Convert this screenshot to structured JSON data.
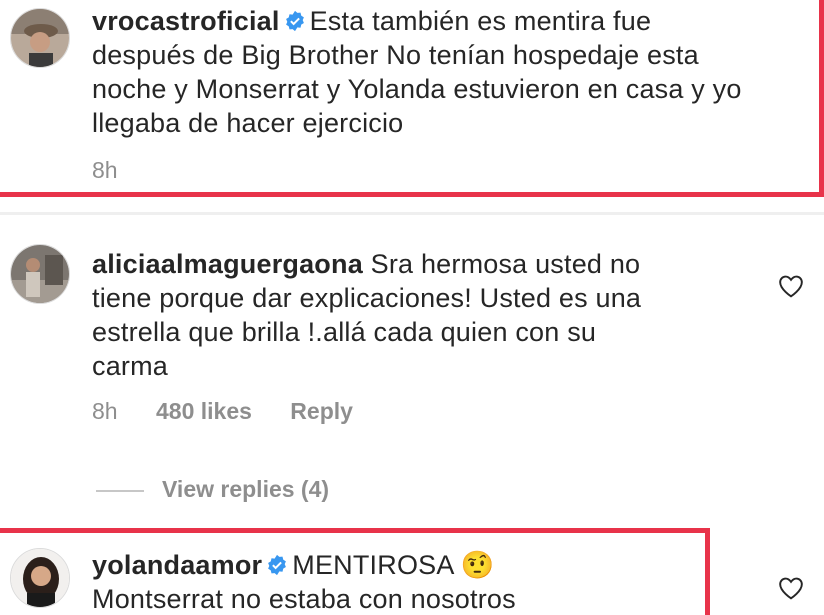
{
  "comments": [
    {
      "username": "vrocastroficial",
      "verified": true,
      "text": "Esta también es mentira fue después de Big Brother No tenían hospedaje esta noche y Monserrat y Yolanda estuvieron en casa y yo llegaba de hacer ejercicio",
      "lines": [
        "Esta también es mentira fue",
        "después de Big Brother No tenían hospedaje esta",
        "noche y Monserrat y Yolanda estuvieron en casa y yo",
        "llegaba de hacer ejercicio"
      ],
      "time": "8h",
      "highlighted": true
    },
    {
      "username": "aliciaalmaguergaona",
      "verified": false,
      "lines": [
        "Sra hermosa usted no",
        "tiene porque dar explicaciones! Usted es una",
        "estrella que brilla !.allá cada quien con su",
        "carma"
      ],
      "time": "8h",
      "likes": "480 likes",
      "reply_label": "Reply",
      "view_replies": "View replies (4)",
      "highlighted": false
    },
    {
      "username": "yolandaamor",
      "verified": true,
      "lines": [
        "MENTIROSA 🤨",
        "Montserrat no estaba con nosotros"
      ],
      "highlighted": true
    }
  ],
  "colors": {
    "highlight": "#e8334a",
    "verified": "#3897f0",
    "meta": "#8e8e8e"
  },
  "icons": {
    "verified": "verified-badge-icon",
    "like": "heart-icon"
  }
}
